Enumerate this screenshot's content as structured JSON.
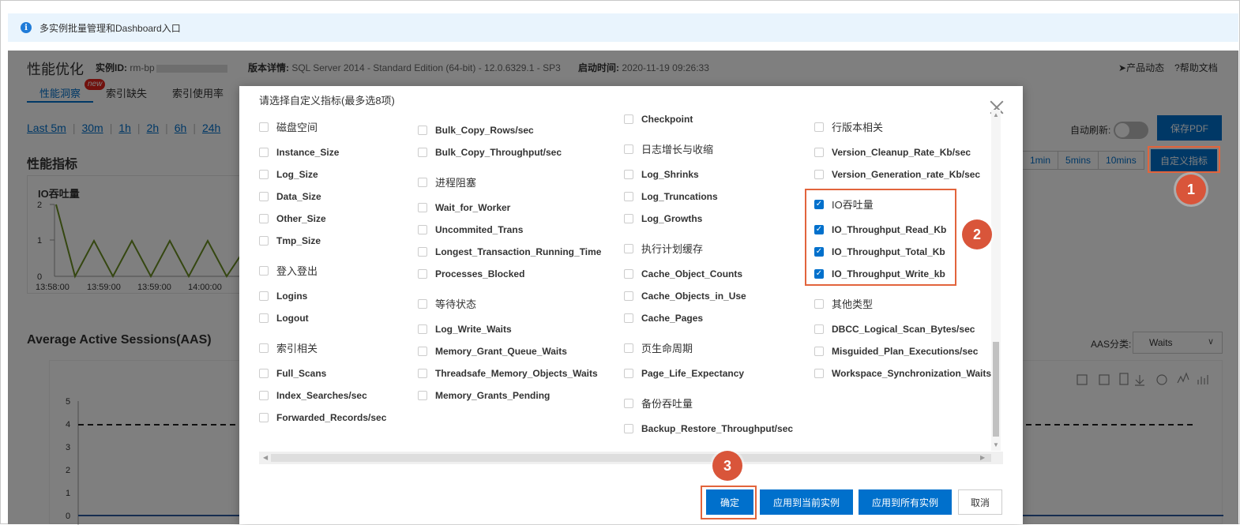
{
  "notice": {
    "text": "多实例批量管理和Dashboard入口"
  },
  "header": {
    "title": "性能优化",
    "instance_label": "实例ID:",
    "instance_value": "rm-bp",
    "version_label": "版本详情:",
    "version_value": "SQL Server 2014 - Standard Edition (64-bit) - 12.0.6329.1 - SP3",
    "start_label": "启动时间:",
    "start_value": "2020-11-19 09:26:33",
    "link_product": "产品动态",
    "link_help": "帮助文档"
  },
  "tabs": [
    {
      "label": "性能洞察",
      "badge": "new"
    },
    {
      "label": "索引缺失"
    },
    {
      "label": "索引使用率"
    }
  ],
  "ranges": [
    "Last 5m",
    "30m",
    "1h",
    "2h",
    "6h",
    "24h"
  ],
  "sections": {
    "metrics": "性能指标",
    "io_chart_title": "IO吞吐量",
    "aas_title": "Average Active Sessions(AAS)"
  },
  "io_chart": {
    "y_ticks": [
      "2",
      "1",
      "0"
    ],
    "x_ticks": [
      "13:58:00",
      "13:59:00",
      "13:59:00",
      "14:00:00"
    ],
    "line_color": "#6b8e23"
  },
  "right_controls": {
    "auto_refresh": "自动刷新:",
    "save_pdf": "保存PDF",
    "intervals": [
      "1min",
      "5mins",
      "10mins"
    ],
    "custom_metrics": "自定义指标",
    "aas_class_label": "AAS分类:",
    "aas_class_value": "Waits"
  },
  "aas_chart": {
    "y_ticks": [
      "5",
      "4",
      "3",
      "2",
      "1",
      "0"
    ],
    "threshold": 4
  },
  "modal": {
    "title": "请选择自定义指标(最多选8项)",
    "columns": [
      [
        {
          "label": "磁盘空间",
          "header": true
        },
        {
          "label": "Instance_Size"
        },
        {
          "label": "Log_Size"
        },
        {
          "label": "Data_Size"
        },
        {
          "label": "Other_Size"
        },
        {
          "label": "Tmp_Size"
        },
        {
          "label": "登入登出",
          "header": true
        },
        {
          "label": "Logins"
        },
        {
          "label": "Logout"
        },
        {
          "label": "索引相关",
          "header": true
        },
        {
          "label": "Full_Scans"
        },
        {
          "label": "Index_Searches/sec"
        },
        {
          "label": "Forwarded_Records/sec"
        }
      ],
      [
        {
          "label": "Bulk_Copy_Rows/sec"
        },
        {
          "label": "Bulk_Copy_Throughput/sec"
        },
        {
          "label": "进程阻塞",
          "header": true
        },
        {
          "label": "Wait_for_Worker"
        },
        {
          "label": "Uncommited_Trans"
        },
        {
          "label": "Longest_Transaction_Running_Time"
        },
        {
          "label": "Processes_Blocked"
        },
        {
          "label": "等待状态",
          "header": true
        },
        {
          "label": "Log_Write_Waits"
        },
        {
          "label": "Memory_Grant_Queue_Waits"
        },
        {
          "label": "Threadsafe_Memory_Objects_Waits"
        },
        {
          "label": "Memory_Grants_Pending"
        }
      ],
      [
        {
          "label": "Checkpoint"
        },
        {
          "label": "日志增长与收缩",
          "header": true
        },
        {
          "label": "Log_Shrinks"
        },
        {
          "label": "Log_Truncations"
        },
        {
          "label": "Log_Growths"
        },
        {
          "label": "执行计划缓存",
          "header": true
        },
        {
          "label": "Cache_Object_Counts"
        },
        {
          "label": "Cache_Objects_in_Use"
        },
        {
          "label": "Cache_Pages"
        },
        {
          "label": "页生命周期",
          "header": true
        },
        {
          "label": "Page_Life_Expectancy"
        },
        {
          "label": "备份吞吐量",
          "header": true
        },
        {
          "label": "Backup_Restore_Throughput/sec"
        }
      ],
      [
        {
          "label": "行版本相关",
          "header": true
        },
        {
          "label": "Version_Cleanup_Rate_Kb/sec"
        },
        {
          "label": "Version_Generation_rate_Kb/sec"
        },
        {
          "label": "IO吞吐量",
          "header": true,
          "checked": true
        },
        {
          "label": "IO_Throughput_Read_Kb",
          "checked": true
        },
        {
          "label": "IO_Throughput_Total_Kb",
          "checked": true
        },
        {
          "label": "IO_Throughput_Write_kb",
          "checked": true
        },
        {
          "label": "其他类型",
          "header": true
        },
        {
          "label": "DBCC_Logical_Scan_Bytes/sec"
        },
        {
          "label": "Misguided_Plan_Executions/sec"
        },
        {
          "label": "Workspace_Synchronization_Waits"
        }
      ]
    ],
    "buttons": {
      "confirm": "确定",
      "apply_current": "应用到当前实例",
      "apply_all": "应用到所有实例",
      "cancel": "取消"
    }
  },
  "steps": [
    "1",
    "2",
    "3"
  ],
  "colors": {
    "accent": "#0070cc",
    "highlight": "#e2643c",
    "step": "#d9553a"
  }
}
